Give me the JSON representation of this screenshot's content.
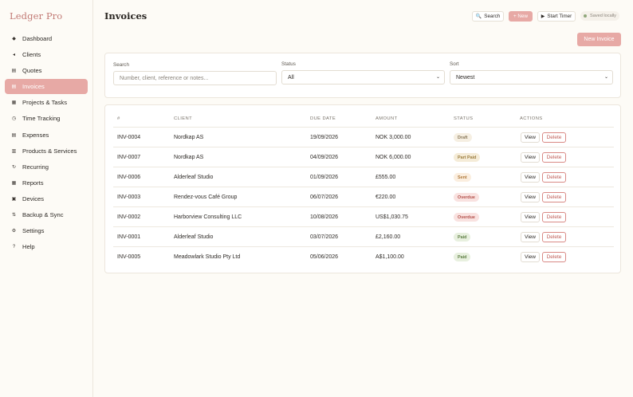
{
  "app": {
    "name": "Ledger Pro"
  },
  "sidebar": {
    "items": [
      {
        "label": "Dashboard",
        "icon": "◆"
      },
      {
        "label": "Clients",
        "icon": "◂"
      },
      {
        "label": "Quotes",
        "icon": "▤"
      },
      {
        "label": "Invoices",
        "icon": "▤"
      },
      {
        "label": "Projects & Tasks",
        "icon": "▦"
      },
      {
        "label": "Time Tracking",
        "icon": "◷"
      },
      {
        "label": "Expenses",
        "icon": "▤"
      },
      {
        "label": "Products & Services",
        "icon": "▥"
      },
      {
        "label": "Recurring",
        "icon": "↻"
      },
      {
        "label": "Reports",
        "icon": "▦"
      },
      {
        "label": "Devices",
        "icon": "▣"
      },
      {
        "label": "Backup & Sync",
        "icon": "⇅"
      },
      {
        "label": "Settings",
        "icon": "⚙"
      },
      {
        "label": "Help",
        "icon": "?"
      }
    ],
    "active": "Invoices"
  },
  "header": {
    "title": "Invoices",
    "search_label": "Search",
    "search_icon": "🔍",
    "new_label": "+ New",
    "timer_label": "Start Timer",
    "timer_icon": "▶",
    "saved_label": "Saved locally",
    "saved_color": "#8fa77a"
  },
  "new_invoice_label": "New Invoice",
  "filters": {
    "search_label": "Search",
    "search_placeholder": "Number, client, reference or notes...",
    "status_label": "Status",
    "status_value": "All",
    "sort_label": "Sort",
    "sort_value": "Newest"
  },
  "table": {
    "headers": [
      "#",
      "Client",
      "Due Date",
      "Amount",
      "Status",
      "Actions"
    ],
    "view_label": "View",
    "delete_label": "Delete",
    "rows": [
      {
        "number": "INV-0004",
        "client": "Nordkap AS",
        "due": "19/09/2026",
        "amount": "NOK 3,000.00",
        "status": "Draft",
        "kind": "draft"
      },
      {
        "number": "INV-0007",
        "client": "Nordkap AS",
        "due": "04/09/2026",
        "amount": "NOK 6,000.00",
        "status": "Part Paid",
        "kind": "part"
      },
      {
        "number": "INV-0006",
        "client": "Alderleaf Studio",
        "due": "01/09/2026",
        "amount": "£555.00",
        "status": "Sent",
        "kind": "sent"
      },
      {
        "number": "INV-0003",
        "client": "Rendez-vous Café Group",
        "due": "06/07/2026",
        "amount": "€220.00",
        "status": "Overdue",
        "kind": "over"
      },
      {
        "number": "INV-0002",
        "client": "Harborview Consulting LLC",
        "due": "10/08/2026",
        "amount": "US$1,030.75",
        "status": "Overdue",
        "kind": "over"
      },
      {
        "number": "INV-0001",
        "client": "Alderleaf Studio",
        "due": "03/07/2026",
        "amount": "£2,160.00",
        "status": "Paid",
        "kind": "paid"
      },
      {
        "number": "INV-0005",
        "client": "Meadowlark Studio Pty Ltd",
        "due": "05/06/2026",
        "amount": "A$1,100.00",
        "status": "Paid",
        "kind": "paid"
      }
    ]
  },
  "colors": {
    "accent": "#e7a9a5",
    "brand": "#c27a75"
  }
}
